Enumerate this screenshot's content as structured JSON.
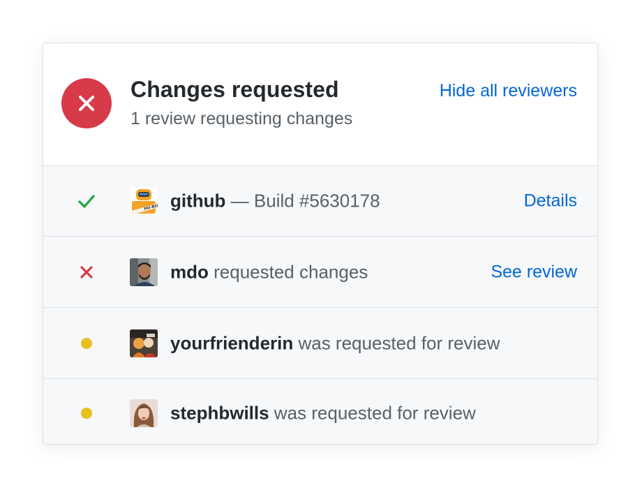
{
  "header": {
    "title": "Changes requested",
    "subtitle": "1 review requesting changes",
    "hide_link": "Hide all reviewers",
    "status_color": "#d73a49"
  },
  "rows": [
    {
      "state": "success",
      "state_icon": "check-icon",
      "avatar": "hubot-avatar",
      "user": "github",
      "detail": " — Build #5630178",
      "link": "Details"
    },
    {
      "state": "changes-requested",
      "state_icon": "x-icon",
      "avatar": "mdo-avatar",
      "user": "mdo",
      "detail": " requested changes",
      "link": "See review"
    },
    {
      "state": "pending",
      "state_icon": "dot-icon",
      "avatar": "yourfrienderin-avatar",
      "user": "yourfrienderin",
      "detail": " was requested for review",
      "link": ""
    },
    {
      "state": "pending",
      "state_icon": "dot-icon",
      "avatar": "stephbwills-avatar",
      "user": "stephbwills",
      "detail": " was requested for review",
      "link": ""
    }
  ],
  "colors": {
    "success": "#28a745",
    "danger": "#d73a49",
    "pending": "#e9c01f",
    "link": "#0366d6"
  }
}
